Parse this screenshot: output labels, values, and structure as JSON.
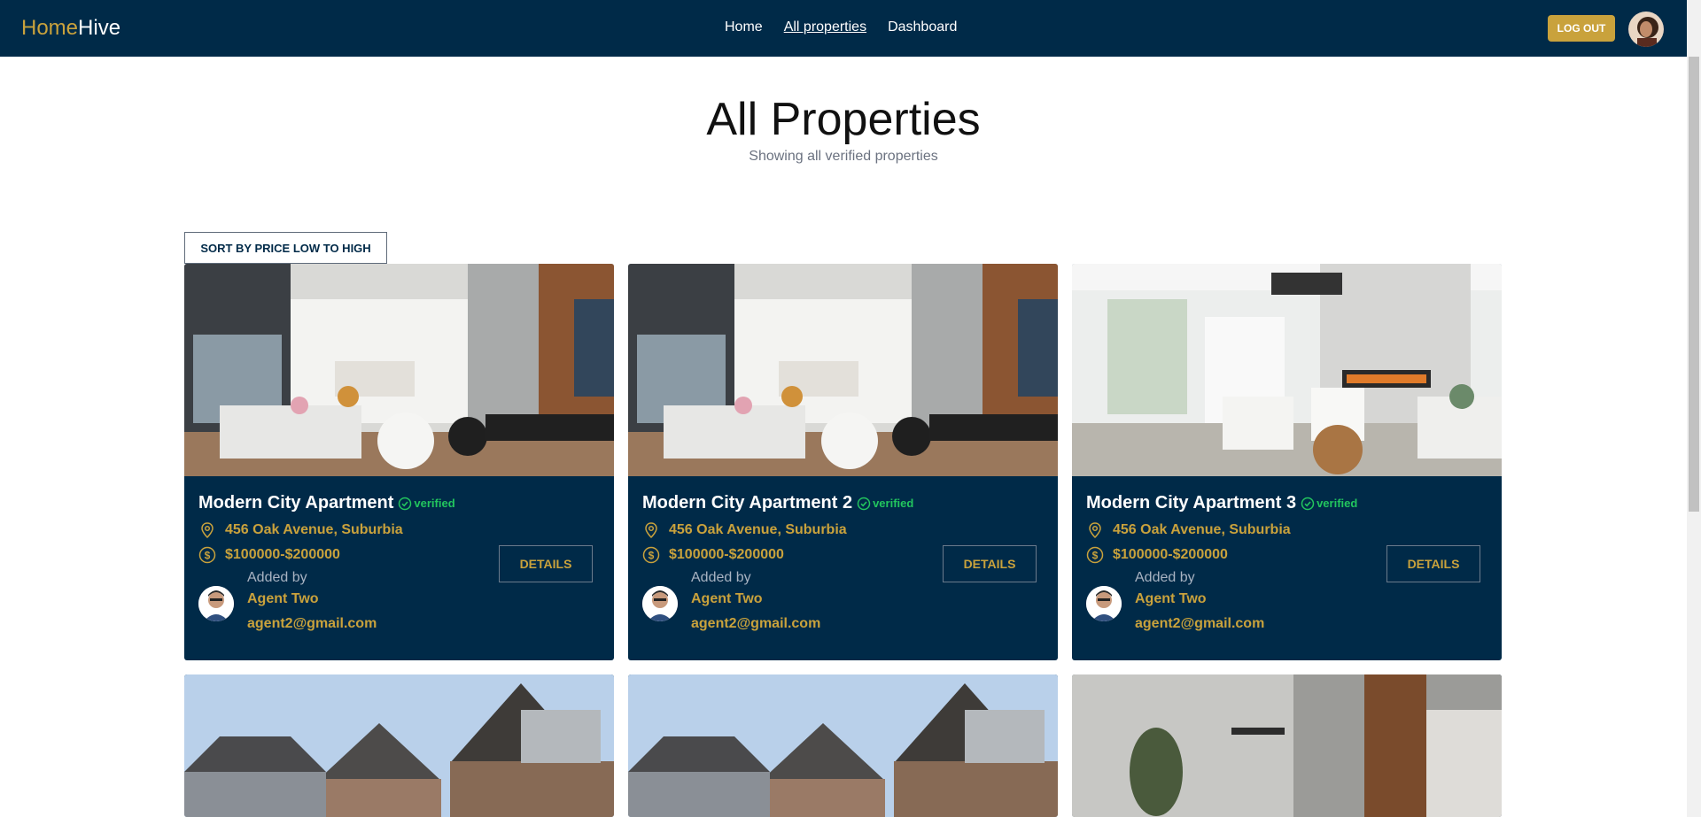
{
  "brand": {
    "part1": "Home",
    "part2": "Hive"
  },
  "nav": {
    "home": "Home",
    "all_properties": "All properties",
    "dashboard": "Dashboard"
  },
  "header": {
    "logout": "LOG OUT"
  },
  "page": {
    "title": "All Properties",
    "subtitle": "Showing all verified properties",
    "sort_label": "SORT BY PRICE LOW TO HIGH"
  },
  "colors": {
    "navy": "#002a48",
    "gold": "#c9a23c",
    "verified": "#22c55e"
  },
  "cards": [
    {
      "title": "Modern City Apartment",
      "verified": "verified",
      "location": "456 Oak Avenue, Suburbia",
      "price": "$100000-$200000",
      "added_by": "Added by",
      "agent_name": "Agent Two",
      "agent_email": "agent2@gmail.com",
      "details": "DETAILS"
    },
    {
      "title": "Modern City Apartment 2",
      "verified": "verified",
      "location": "456 Oak Avenue, Suburbia",
      "price": "$100000-$200000",
      "added_by": "Added by",
      "agent_name": "Agent Two",
      "agent_email": "agent2@gmail.com",
      "details": "DETAILS"
    },
    {
      "title": "Modern City Apartment 3",
      "verified": "verified",
      "location": "456 Oak Avenue, Suburbia",
      "price": "$100000-$200000",
      "added_by": "Added by",
      "agent_name": "Agent Two",
      "agent_email": "agent2@gmail.com",
      "details": "DETAILS"
    }
  ]
}
